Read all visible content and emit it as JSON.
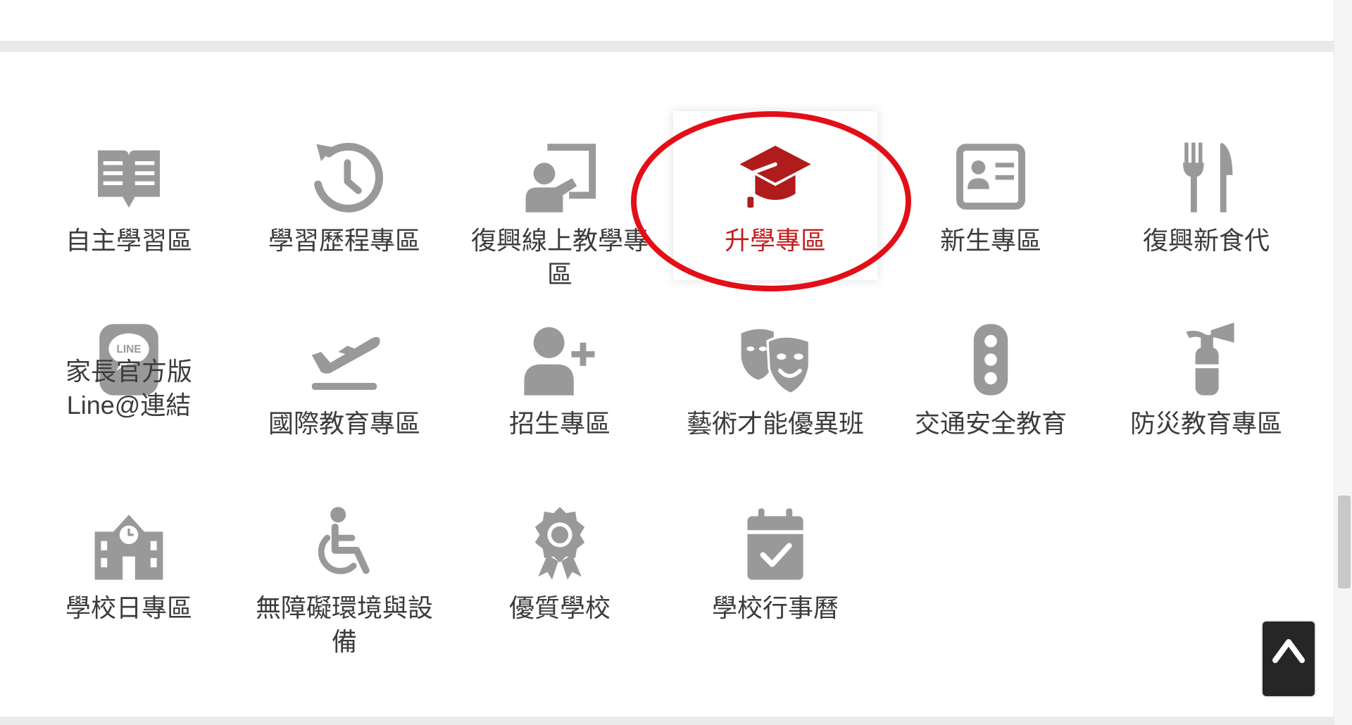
{
  "colors": {
    "icon_gray": "#999999",
    "label_gray": "#3c3c3c",
    "active_red": "#b01c1c",
    "active_label_red": "#c21f1f",
    "highlight_ring": "#e30e17",
    "back_to_top_bg": "#262626"
  },
  "quick_links": [
    {
      "label": "自主學習區",
      "icon": "book-icon"
    },
    {
      "label": "學習歷程專區",
      "icon": "history-icon"
    },
    {
      "label": "復興線上教學專區",
      "icon": "chalkboard-teacher-icon"
    },
    {
      "label": "升學專區",
      "icon": "graduation-cap-icon",
      "active": true
    },
    {
      "label": "新生專區",
      "icon": "id-card-icon"
    },
    {
      "label": "復興新食代",
      "icon": "utensils-icon"
    },
    {
      "label": "家長官方版Line@連結",
      "icon": "line-app-icon",
      "icon_text": "LINE"
    },
    {
      "label": "國際教育專區",
      "icon": "plane-departure-icon"
    },
    {
      "label": "招生專區",
      "icon": "user-plus-icon"
    },
    {
      "label": "藝術才能優異班",
      "icon": "theater-masks-icon"
    },
    {
      "label": "交通安全教育",
      "icon": "traffic-light-icon"
    },
    {
      "label": "防災教育專區",
      "icon": "fire-extinguisher-icon"
    },
    {
      "label": "學校日專區",
      "icon": "school-icon"
    },
    {
      "label": "無障礙環境與設備",
      "icon": "wheelchair-icon"
    },
    {
      "label": "優質學校",
      "icon": "award-icon"
    },
    {
      "label": "學校行事曆",
      "icon": "calendar-check-icon"
    }
  ],
  "back_to_top": {
    "icon": "chevron-up-icon"
  }
}
